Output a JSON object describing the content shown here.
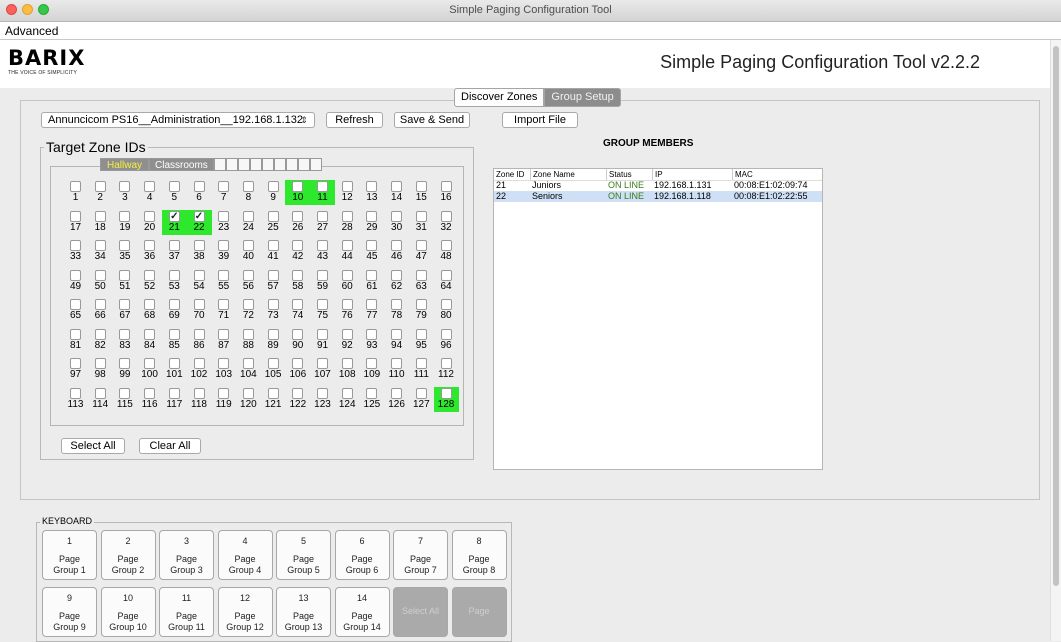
{
  "window": {
    "title": "Simple Paging Configuration Tool"
  },
  "menu": {
    "items": [
      "Advanced"
    ]
  },
  "header": {
    "logo": "BARIX",
    "tagline": "THE VOICE OF SIMPLICITY",
    "title": "Simple Paging Configuration Tool v2.2.2"
  },
  "tabs": {
    "discover": "Discover Zones",
    "group": "Group Setup",
    "active": "Group Setup"
  },
  "toolbar": {
    "device_select": "Annuncicom PS16__Administration__192.168.1.132",
    "refresh": "Refresh",
    "save_send": "Save & Send",
    "import": "Import File"
  },
  "target_zones": {
    "legend": "Target Zone IDs",
    "subtabs": [
      "Hallway",
      "Classrooms"
    ],
    "active_subtab": "Hallway",
    "empty_subtab_count": 9,
    "highlighted": [
      10,
      11,
      21,
      22,
      128
    ],
    "checked": [
      21,
      22
    ],
    "select_all": "Select All",
    "clear_all": "Clear All"
  },
  "group_members": {
    "title": "GROUP MEMBERS",
    "columns": [
      "Zone ID",
      "Zone Name",
      "Status",
      "IP",
      "MAC"
    ],
    "rows": [
      {
        "id": "21",
        "name": "Juniors",
        "status": "ON LINE",
        "ip": "192.168.1.131",
        "mac": "00:08:E1:02:09:74",
        "selected": false
      },
      {
        "id": "22",
        "name": "Seniors",
        "status": "ON LINE",
        "ip": "192.168.1.118",
        "mac": "00:08:E1:02:22:55",
        "selected": true
      }
    ]
  },
  "keyboard": {
    "legend": "KEYBOARD",
    "keys": [
      {
        "num": "1",
        "label": [
          "Page",
          "Group 1"
        ]
      },
      {
        "num": "2",
        "label": [
          "Page",
          "Group 2"
        ]
      },
      {
        "num": "3",
        "label": [
          "Page",
          "Group 3"
        ]
      },
      {
        "num": "4",
        "label": [
          "Page",
          "Group 4"
        ]
      },
      {
        "num": "5",
        "label": [
          "Page",
          "Group 5"
        ]
      },
      {
        "num": "6",
        "label": [
          "Page",
          "Group 6"
        ]
      },
      {
        "num": "7",
        "label": [
          "Page",
          "Group 7"
        ]
      },
      {
        "num": "8",
        "label": [
          "Page",
          "Group 8"
        ]
      },
      {
        "num": "9",
        "label": [
          "Page",
          "Group 9"
        ]
      },
      {
        "num": "10",
        "label": [
          "Page",
          "Group 10"
        ]
      },
      {
        "num": "11",
        "label": [
          "Page",
          "Group 11"
        ]
      },
      {
        "num": "12",
        "label": [
          "Page",
          "Group 12"
        ]
      },
      {
        "num": "13",
        "label": [
          "Page",
          "Group 13"
        ]
      },
      {
        "num": "14",
        "label": [
          "Page",
          "Group 14"
        ]
      },
      {
        "num": "",
        "label": [
          "Select All"
        ],
        "disabled": true
      },
      {
        "num": "",
        "label": [
          "Page"
        ],
        "disabled": true
      }
    ]
  }
}
